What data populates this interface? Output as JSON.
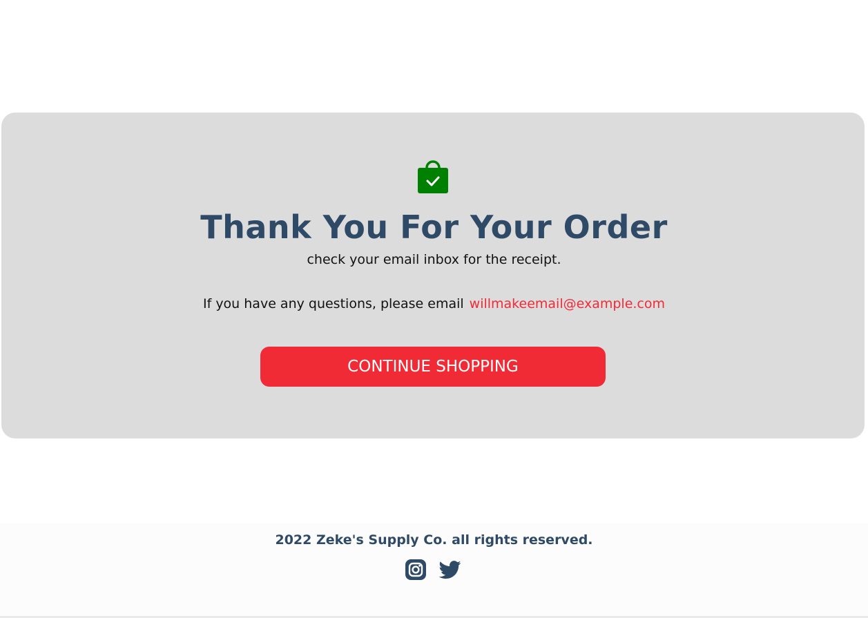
{
  "confirmation": {
    "title": "Thank You For Your Order",
    "subtitle": "check your email inbox for the receipt.",
    "question_text": "If you have any questions, please email",
    "email": "willmakeemail@example.com",
    "continue_label": "CONTINUE SHOPPING",
    "icon": "shopping-bag-check-icon"
  },
  "footer": {
    "copyright": "2022 Zeke's Supply Co. all rights reserved.",
    "social": [
      {
        "icon": "instagram-icon"
      },
      {
        "icon": "twitter-icon"
      }
    ]
  },
  "colors": {
    "card_background": "#dcdcdd",
    "heading": "#2f4a66",
    "accent": "#f02b35",
    "bag_icon": "#008000"
  }
}
